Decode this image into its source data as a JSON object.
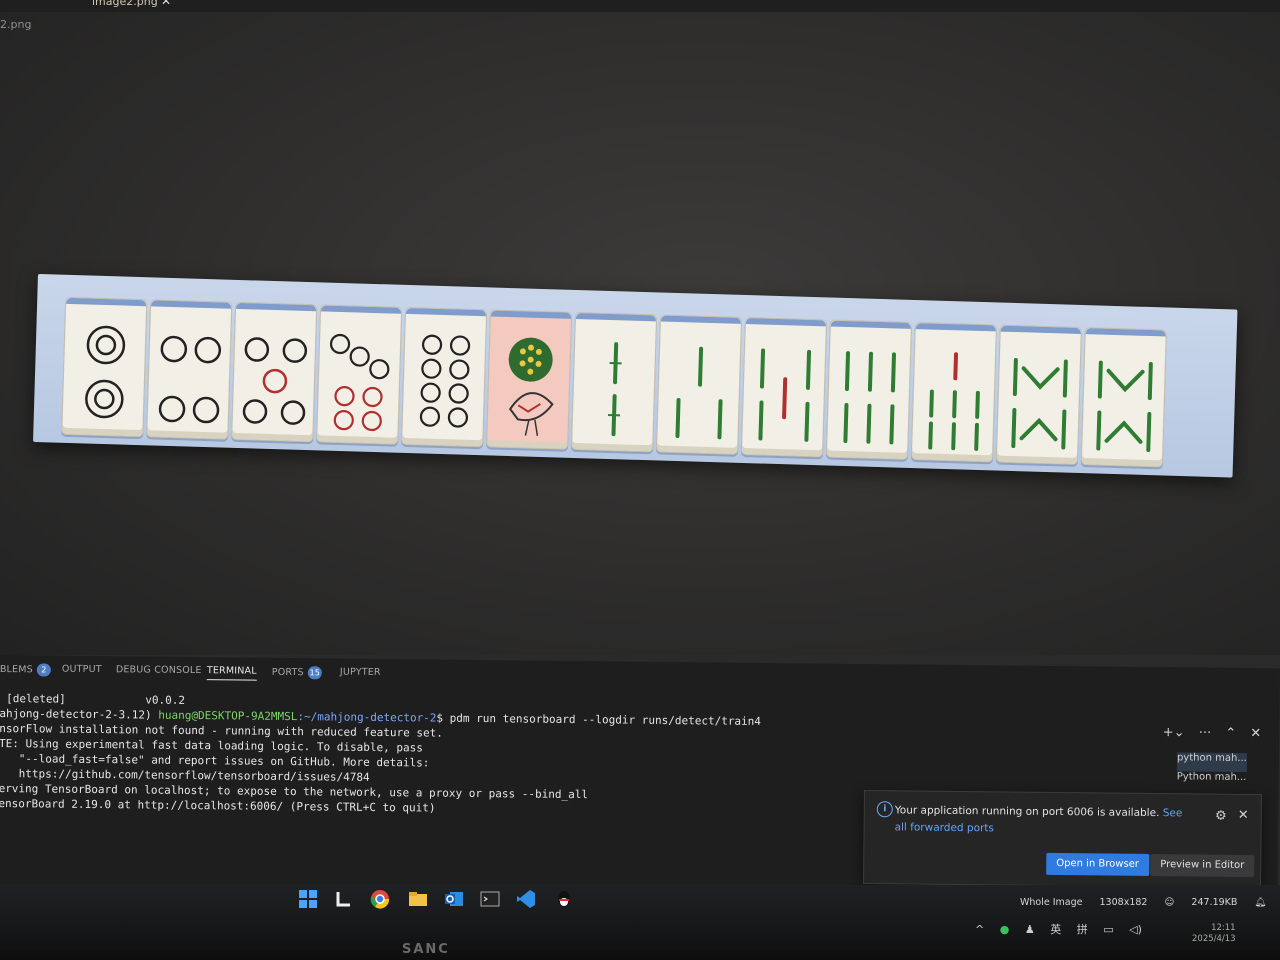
{
  "editor": {
    "tab_title": "image2.png",
    "breadcrumb": "2.png"
  },
  "tiles": [
    {
      "name": "2 circles"
    },
    {
      "name": "4 circles"
    },
    {
      "name": "5 circles"
    },
    {
      "name": "7 circles"
    },
    {
      "name": "8 circles"
    },
    {
      "name": "1 circle peacock"
    },
    {
      "name": "2 bamboo"
    },
    {
      "name": "3 bamboo"
    },
    {
      "name": "5 bamboo"
    },
    {
      "name": "6 bamboo"
    },
    {
      "name": "7 bamboo"
    },
    {
      "name": "8 bamboo"
    },
    {
      "name": "8 bamboo"
    }
  ],
  "panel": {
    "tabs": [
      {
        "label": "BLEMS",
        "badge": "2"
      },
      {
        "label": "OUTPUT"
      },
      {
        "label": "DEBUG CONSOLE"
      },
      {
        "label": "TERMINAL"
      },
      {
        "label": "PORTS",
        "badge": "15"
      },
      {
        "label": "JUPYTER"
      }
    ],
    "terminal": {
      "line1_left": " [deleted]",
      "line1_right": "v0.0.2",
      "line2_env": "ahjong-detector-2-3.12) ",
      "line2_user": "huang@DESKTOP-9A2MMSL",
      "line2_path": ":~/mahjong-detector-2",
      "line2_cmd": "$ pdm run tensorboard --logdir runs/detect/train4",
      "line3": "nsorFlow installation not found - running with reduced feature set.",
      "line4": "",
      "line5": "TE: Using experimental fast data loading logic. To disable, pass",
      "line6": "   \"--load_fast=false\" and report issues on GitHub. More details:",
      "line7": "   https://github.com/tensorflow/tensorboard/issues/4784",
      "line8": "",
      "line9": "erving TensorBoard on localhost; to expose to the network, use a proxy or pass --bind_all",
      "line10": "ensorBoard 2.19.0 at http://localhost:6006/ (Press CTRL+C to quit)"
    },
    "terminal_list": [
      {
        "label": "python  mah..."
      },
      {
        "label": "Python  mah..."
      }
    ]
  },
  "notification": {
    "message": "Your application running on port 6006 is available.",
    "link": "See all forwarded ports",
    "open_button": "Open in Browser",
    "preview_button": "Preview in Editor"
  },
  "statusbar": {
    "image_scope": "Whole Image",
    "dimensions": "1308x182",
    "file_size": "247.19KB"
  },
  "tray": {
    "ime1": "英",
    "ime2": "拼",
    "time": "12:11",
    "date": "2025/4/13"
  },
  "monitor": {
    "brand": "SANC"
  }
}
